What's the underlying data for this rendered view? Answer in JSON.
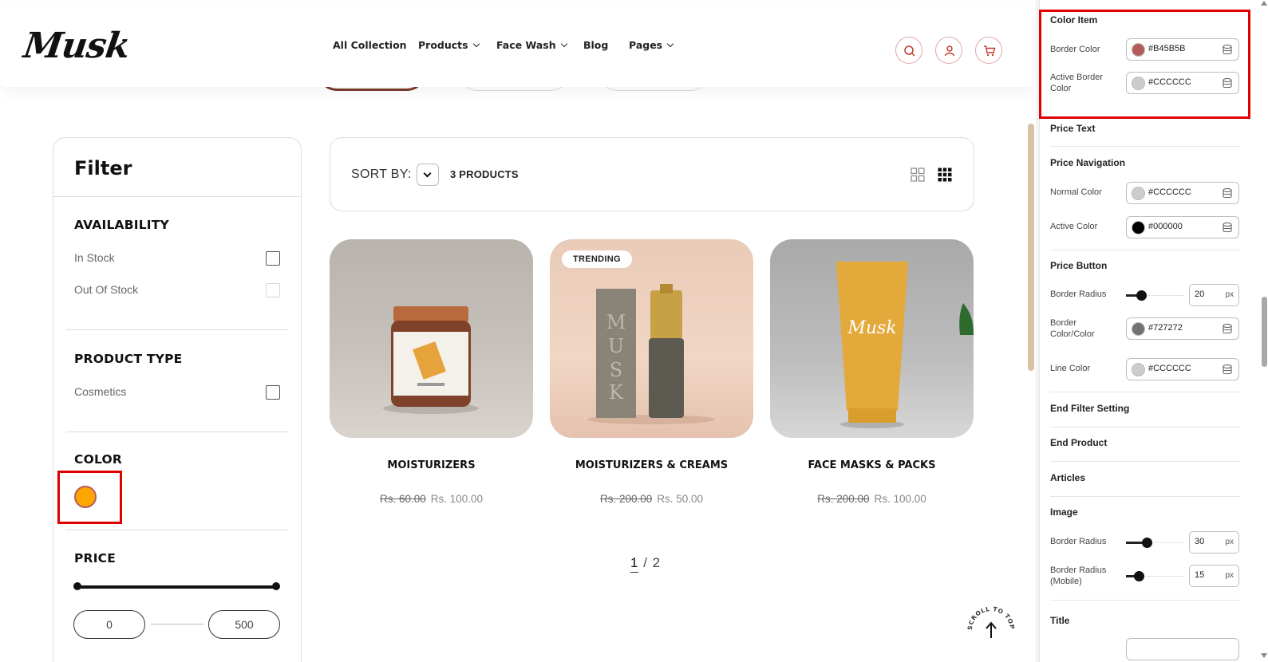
{
  "header": {
    "logo": "Musk",
    "nav": [
      {
        "label": "All Collection"
      },
      {
        "label": "Products"
      },
      {
        "label": "Face Wash"
      },
      {
        "label": "Blog"
      },
      {
        "label": "Pages"
      }
    ],
    "icons": [
      "search-icon",
      "user-icon",
      "cart-icon"
    ]
  },
  "filter": {
    "title": "Filter",
    "availability": {
      "heading": "AVAILABILITY",
      "options": [
        {
          "label": "In Stock",
          "disabled": false
        },
        {
          "label": "Out Of Stock",
          "disabled": true
        }
      ]
    },
    "product_type": {
      "heading": "PRODUCT TYPE",
      "options": [
        {
          "label": "Cosmetics"
        }
      ]
    },
    "color": {
      "heading": "COLOR",
      "swatch_fill": "#FFA500",
      "swatch_border": "#B45B5B"
    },
    "price": {
      "heading": "PRICE",
      "min": "0",
      "max": "500"
    }
  },
  "toolbar": {
    "sort_label": "SORT BY:",
    "count": "3 PRODUCTS"
  },
  "products": [
    {
      "name": "MOISTURIZERS",
      "old_price": "Rs. 60.00",
      "price": "Rs. 100.00",
      "badge": ""
    },
    {
      "name": "MOISTURIZERS & CREAMS",
      "old_price": "Rs. 200.00",
      "price": "Rs. 50.00",
      "badge": "TRENDING"
    },
    {
      "name": "FACE MASKS & PACKS",
      "old_price": "Rs. 200.00",
      "price": "Rs. 100.00",
      "badge": ""
    }
  ],
  "pagination": {
    "current": "1",
    "separator": "/",
    "total": "2"
  },
  "scroll_top_label": "SCROLL TO TOP",
  "panel": {
    "color_item": {
      "title": "Color Item",
      "border_color_label": "Border Color",
      "border_color": "#B45B5B",
      "active_border_label": "Active Border Color",
      "active_border_color": "#CCCCCC"
    },
    "price_text": {
      "title": "Price Text"
    },
    "price_navigation": {
      "title": "Price Navigation",
      "normal_label": "Normal Color",
      "normal_color": "#CCCCCC",
      "active_label": "Active Color",
      "active_color": "#000000"
    },
    "price_button": {
      "title": "Price Button",
      "radius_label": "Border Radius",
      "radius_value": "20",
      "radius_unit": "px",
      "border_label": "Border Color/Color",
      "border_color": "#727272",
      "line_label": "Line Color",
      "line_color": "#CCCCCC"
    },
    "end_filter": {
      "title": "End Filter Setting"
    },
    "end_product": {
      "title": "End Product"
    },
    "articles": {
      "title": "Articles"
    },
    "image": {
      "title": "Image",
      "radius_label": "Border Radius",
      "radius_value": "30",
      "radius_unit": "px",
      "radius_mobile_label": "Border Radius (Mobile)",
      "radius_mobile_value": "15",
      "radius_mobile_unit": "px"
    },
    "title_section": {
      "title": "Title"
    }
  },
  "colors": {
    "accent_red": "#e00000",
    "icon_border": "#e0a5a5"
  }
}
